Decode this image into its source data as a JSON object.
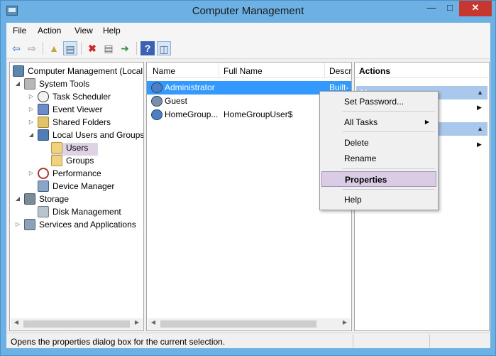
{
  "window": {
    "title": "Computer Management"
  },
  "menubar": [
    "File",
    "Action",
    "View",
    "Help"
  ],
  "toolbar": {
    "icons": [
      "back-arrow-icon",
      "forward-arrow-icon",
      "up-folder-icon",
      "show-hide-console-tree-icon",
      "delete-icon",
      "properties-icon",
      "export-list-icon",
      "help-icon",
      "show-hide-action-pane-icon"
    ]
  },
  "tree": [
    "Computer Management (Local",
    "System Tools",
    "Task Scheduler",
    "Event Viewer",
    "Shared Folders",
    "Local Users and Groups",
    "Users",
    "Groups",
    "Performance",
    "Device Manager",
    "Storage",
    "Disk Management",
    "Services and Applications"
  ],
  "list": {
    "columns": [
      "Name",
      "Full Name",
      "Descr"
    ],
    "rows": [
      {
        "name": "Administrator",
        "full_name": "",
        "desc": "Built-"
      },
      {
        "name": "Guest",
        "full_name": "",
        "desc": ""
      },
      {
        "name": "HomeGroup...",
        "full_name": "HomeGroupUser$",
        "desc": ""
      }
    ]
  },
  "actions": {
    "header": "Actions",
    "sections": [
      "Users",
      ""
    ]
  },
  "context_menu": [
    "Set Password...",
    "All Tasks",
    "Delete",
    "Rename",
    "Properties",
    "Help"
  ],
  "statusbar": {
    "text": "Opens the properties dialog box for the current selection."
  },
  "colors": {
    "selection": "#3399ff",
    "titlebar": "#6cb0e4",
    "close": "#c7372f",
    "tree_selection": "#ded3e5",
    "menu_highlight": "#d9cce4"
  }
}
